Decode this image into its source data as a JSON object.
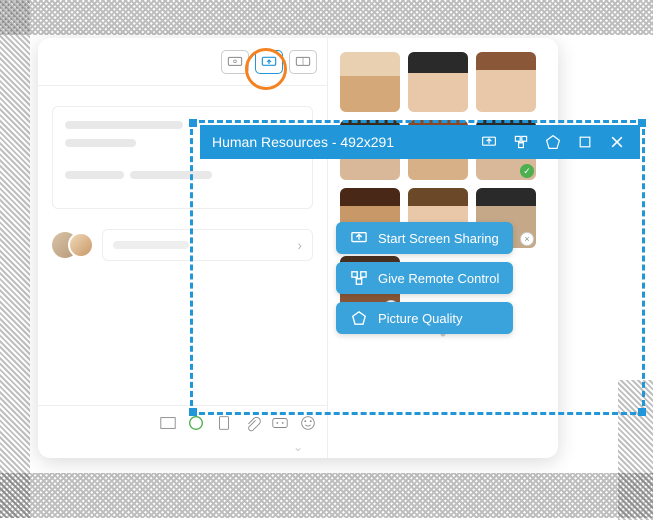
{
  "toolbar": {
    "icons": [
      "presentation-icon",
      "screen-share-icon",
      "layout-icon"
    ]
  },
  "float_bar": {
    "title": "Human Resources - 492x291",
    "controls": [
      "screen-share-icon",
      "remote-control-icon",
      "quality-icon",
      "maximize-icon",
      "close-icon"
    ]
  },
  "actions": {
    "share": "Start Screen Sharing",
    "remote": "Give Remote Control",
    "quality": "Picture Quality"
  },
  "colors": {
    "accent": "#2196d8",
    "highlight_ring": "#f58220",
    "action_button": "#3ba3dc",
    "success": "#4caf50"
  },
  "participants_count": 10
}
